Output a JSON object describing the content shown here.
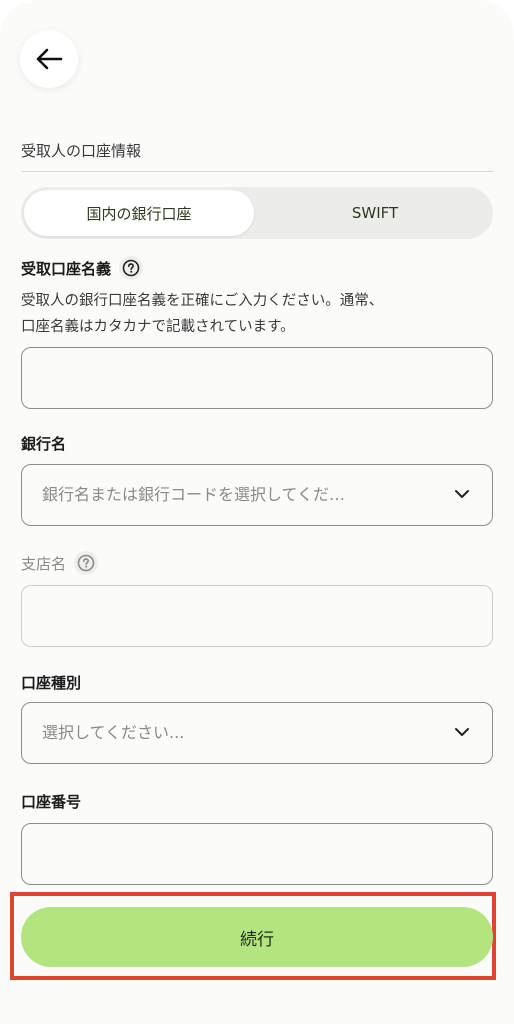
{
  "header": {
    "back_icon": "arrow-left-icon"
  },
  "section": {
    "title": "受取人の口座情報"
  },
  "tabs": [
    {
      "label": "国内の銀行口座",
      "active": true
    },
    {
      "label": "SWIFT",
      "active": false
    }
  ],
  "fields": {
    "account_name": {
      "label": "受取口座名義",
      "description_line1": "受取人の銀行口座名義を正確にご入力ください。通常、",
      "description_line2": "口座名義はカタカナで記載されています。",
      "value": ""
    },
    "bank_name": {
      "label": "銀行名",
      "placeholder": "銀行名または銀行コードを選択してくだ…"
    },
    "branch_name": {
      "label": "支店名",
      "value": ""
    },
    "account_type": {
      "label": "口座種別",
      "placeholder": "選択してください..."
    },
    "account_number": {
      "label": "口座番号",
      "value": ""
    }
  },
  "actions": {
    "continue_label": "続行"
  },
  "colors": {
    "accent": "#b2e580",
    "highlight": "#e0442e"
  }
}
